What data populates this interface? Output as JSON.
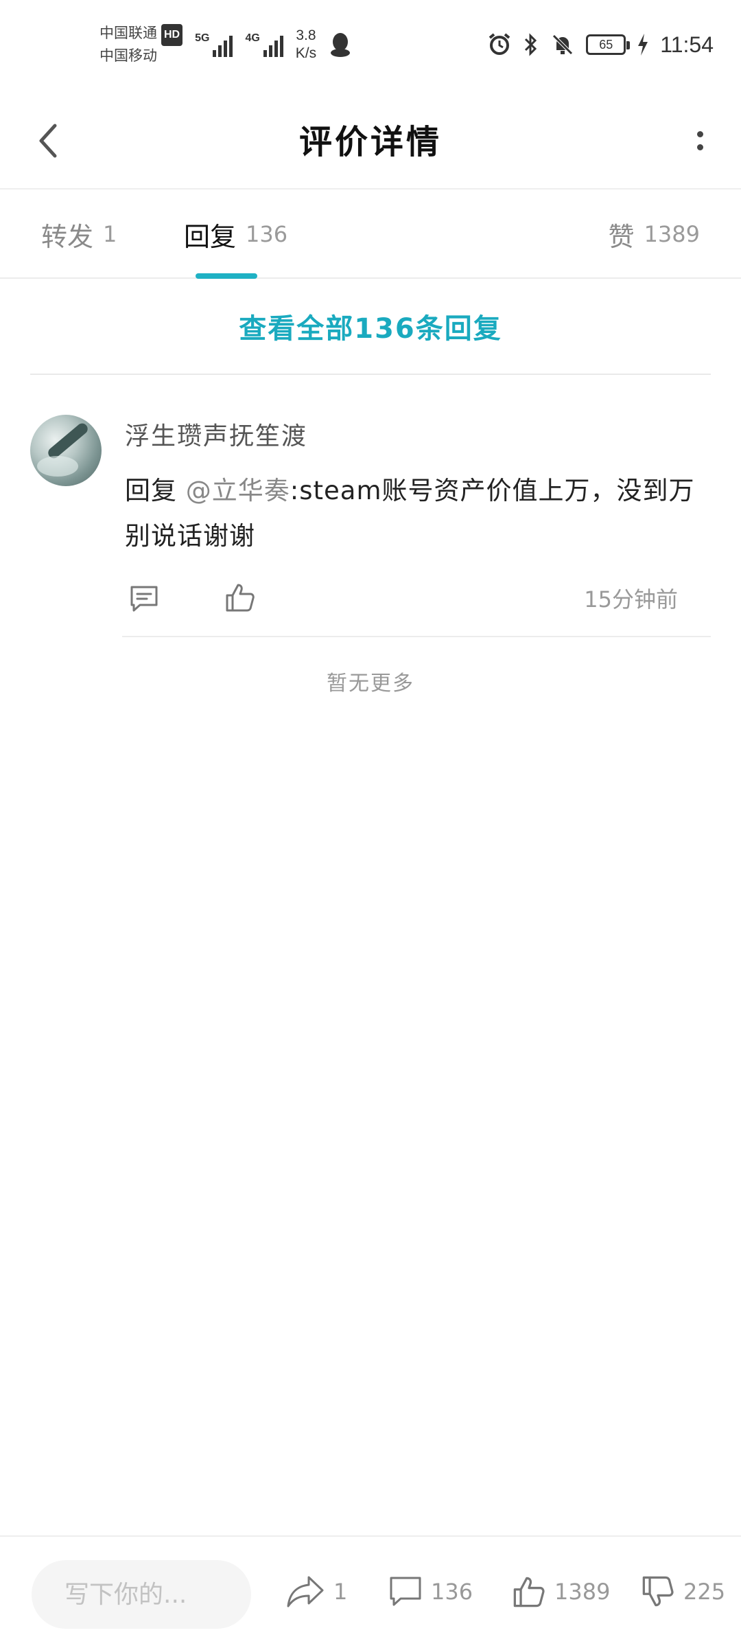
{
  "status_bar": {
    "carrier_1": "中国联通",
    "hd_badge": "HD",
    "carrier_2": "中国移动",
    "signal_1_label": "5G",
    "signal_2_label": "4G",
    "net_speed_value": "3.8",
    "net_speed_unit": "K/s",
    "battery_level": "65",
    "time": "11:54"
  },
  "header": {
    "title": "评价详情",
    "back_icon": "chevron-left-icon",
    "more_icon": "more-vertical-icon"
  },
  "tabs": [
    {
      "label": "转发",
      "count": "1",
      "active": false
    },
    {
      "label": "回复",
      "count": "136",
      "active": true
    },
    {
      "label": "赞",
      "count": "1389",
      "active": false
    }
  ],
  "accent_color": "#1fb1c4",
  "view_all": "查看全部136条回复",
  "comment": {
    "username": "浮生瓒声抚笙渡",
    "reply_prefix": "回复",
    "mention": "@立华奏",
    "text": ":steam账号资产价值上万，没到万别说话谢谢",
    "time": "15分钟前",
    "reply_icon": "comment-icon",
    "like_icon": "thumbs-up-icon"
  },
  "no_more": "暂无更多",
  "bottom_bar": {
    "input_placeholder": "写下你的...",
    "forward_count": "1",
    "comment_count": "136",
    "like_count": "1389",
    "dislike_count": "225"
  }
}
